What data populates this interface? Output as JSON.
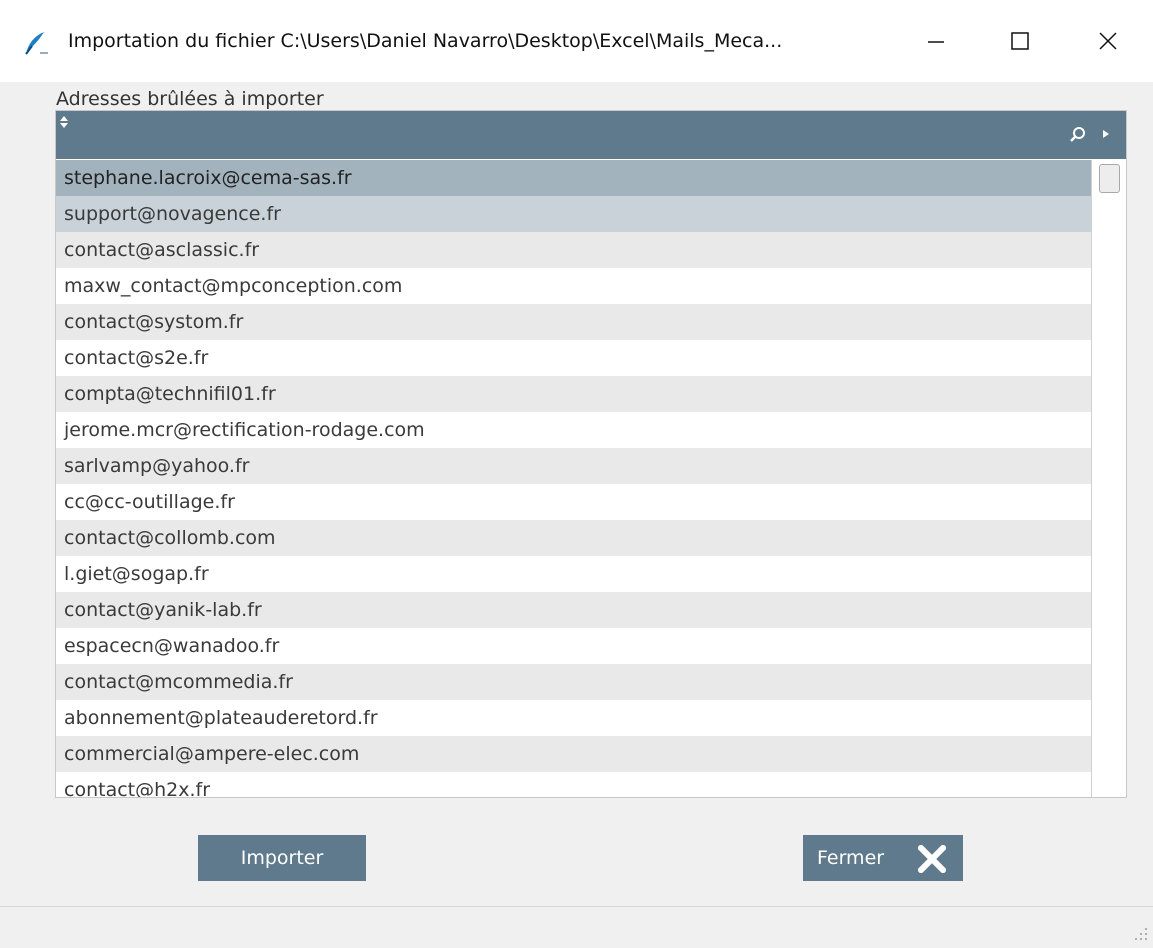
{
  "window": {
    "title": "Importation du fichier C:\\Users\\Daniel Navarro\\Desktop\\Excel\\Mails_Meca...",
    "icon": "feather-icon",
    "controls": [
      "minimize-icon",
      "maximize-icon",
      "close-icon"
    ]
  },
  "panel": {
    "label": "Adresses brûlées à importer"
  },
  "grid": {
    "header_icons": [
      "sort-icon",
      "search-icon",
      "expand-arrow-icon"
    ],
    "selected_rows": [
      0,
      1
    ],
    "rows": [
      "stephane.lacroix@cema-sas.fr",
      "support@novagence.fr",
      "contact@asclassic.fr",
      "maxw_contact@mpconception.com",
      "contact@systom.fr",
      "contact@s2e.fr",
      "compta@technifil01.fr",
      "jerome.mcr@rectification-rodage.com",
      "sarlvamp@yahoo.fr",
      "cc@cc-outillage.fr",
      "contact@collomb.com",
      "l.giet@sogap.fr",
      "contact@yanik-lab.fr",
      "espacecn@wanadoo.fr",
      "contact@mcommedia.fr",
      "abonnement@plateauderetord.fr",
      "commercial@ampere-elec.com",
      "contact@h2x.fr"
    ]
  },
  "buttons": {
    "import_label": "Importer",
    "close_label": "Fermer"
  },
  "colors": {
    "header": "#5f7a8c",
    "selected_row": "#a3b3bd",
    "alt_row": "#e9e9e9",
    "button": "#5f7a8c"
  }
}
